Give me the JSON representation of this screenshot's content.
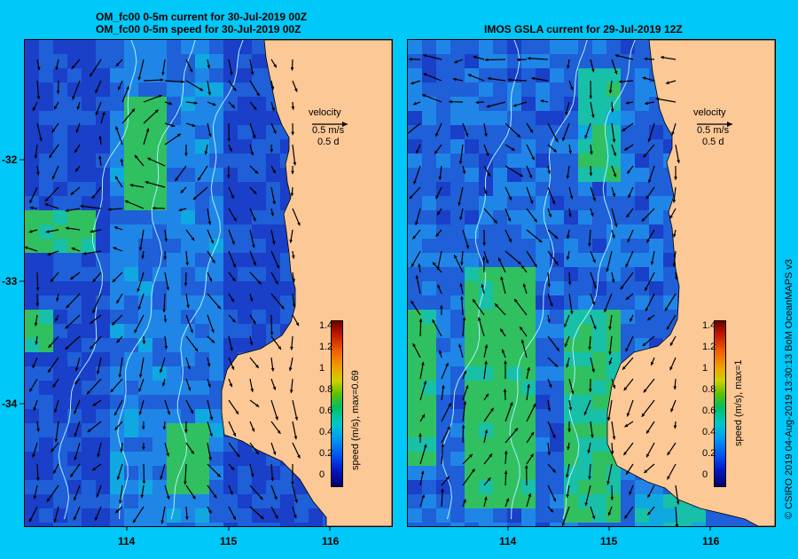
{
  "panels": {
    "left": {
      "title_line1": "OM_fc00 0-5m current for 30-Jul-2019 00Z",
      "title_line2": "OM_fc00 0-5m speed for 30-Jul-2019 00Z",
      "legend_title": "velocity",
      "legend_speed": "0.5 m/s",
      "legend_days": "0.5 d",
      "colorbar_label": "speed (m/s), max=0.69"
    },
    "right": {
      "title_line1": "IMOS GSLA current for 29-Jul-2019 12Z",
      "legend_title": "velocity",
      "legend_speed": "0.5 m/s",
      "legend_days": "0.5 d",
      "colorbar_label": "speed (m/s), max=1"
    }
  },
  "colorbar_ticks": [
    "1.4",
    "1.2",
    "1",
    "0.8",
    "0.6",
    "0.4",
    "0.2",
    "0"
  ],
  "axes": {
    "lat_ticks": [
      "-32",
      "-33",
      "-34"
    ],
    "lon_ticks": [
      "114",
      "115",
      "116"
    ]
  },
  "credit": "© CSIRO 2019   04-Aug-2019 13:30:13 BoM OceanMAPS v3",
  "colors": {
    "background": "#00c8f8",
    "land": "#fcc896",
    "ocean_low": "#1f5fd8",
    "ocean_high": "#38c060"
  }
}
